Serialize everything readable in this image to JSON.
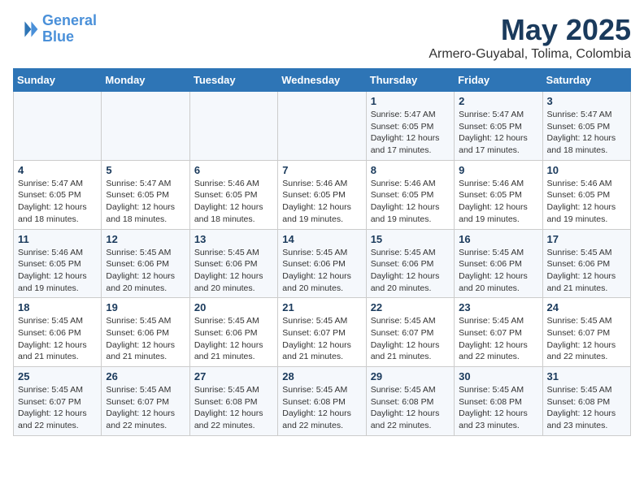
{
  "header": {
    "logo_line1": "General",
    "logo_line2": "Blue",
    "month_year": "May 2025",
    "location": "Armero-Guyabal, Tolima, Colombia"
  },
  "days_of_week": [
    "Sunday",
    "Monday",
    "Tuesday",
    "Wednesday",
    "Thursday",
    "Friday",
    "Saturday"
  ],
  "weeks": [
    [
      {
        "num": "",
        "info": ""
      },
      {
        "num": "",
        "info": ""
      },
      {
        "num": "",
        "info": ""
      },
      {
        "num": "",
        "info": ""
      },
      {
        "num": "1",
        "info": "Sunrise: 5:47 AM\nSunset: 6:05 PM\nDaylight: 12 hours\nand 17 minutes."
      },
      {
        "num": "2",
        "info": "Sunrise: 5:47 AM\nSunset: 6:05 PM\nDaylight: 12 hours\nand 17 minutes."
      },
      {
        "num": "3",
        "info": "Sunrise: 5:47 AM\nSunset: 6:05 PM\nDaylight: 12 hours\nand 18 minutes."
      }
    ],
    [
      {
        "num": "4",
        "info": "Sunrise: 5:47 AM\nSunset: 6:05 PM\nDaylight: 12 hours\nand 18 minutes."
      },
      {
        "num": "5",
        "info": "Sunrise: 5:47 AM\nSunset: 6:05 PM\nDaylight: 12 hours\nand 18 minutes."
      },
      {
        "num": "6",
        "info": "Sunrise: 5:46 AM\nSunset: 6:05 PM\nDaylight: 12 hours\nand 18 minutes."
      },
      {
        "num": "7",
        "info": "Sunrise: 5:46 AM\nSunset: 6:05 PM\nDaylight: 12 hours\nand 19 minutes."
      },
      {
        "num": "8",
        "info": "Sunrise: 5:46 AM\nSunset: 6:05 PM\nDaylight: 12 hours\nand 19 minutes."
      },
      {
        "num": "9",
        "info": "Sunrise: 5:46 AM\nSunset: 6:05 PM\nDaylight: 12 hours\nand 19 minutes."
      },
      {
        "num": "10",
        "info": "Sunrise: 5:46 AM\nSunset: 6:05 PM\nDaylight: 12 hours\nand 19 minutes."
      }
    ],
    [
      {
        "num": "11",
        "info": "Sunrise: 5:46 AM\nSunset: 6:05 PM\nDaylight: 12 hours\nand 19 minutes."
      },
      {
        "num": "12",
        "info": "Sunrise: 5:45 AM\nSunset: 6:06 PM\nDaylight: 12 hours\nand 20 minutes."
      },
      {
        "num": "13",
        "info": "Sunrise: 5:45 AM\nSunset: 6:06 PM\nDaylight: 12 hours\nand 20 minutes."
      },
      {
        "num": "14",
        "info": "Sunrise: 5:45 AM\nSunset: 6:06 PM\nDaylight: 12 hours\nand 20 minutes."
      },
      {
        "num": "15",
        "info": "Sunrise: 5:45 AM\nSunset: 6:06 PM\nDaylight: 12 hours\nand 20 minutes."
      },
      {
        "num": "16",
        "info": "Sunrise: 5:45 AM\nSunset: 6:06 PM\nDaylight: 12 hours\nand 20 minutes."
      },
      {
        "num": "17",
        "info": "Sunrise: 5:45 AM\nSunset: 6:06 PM\nDaylight: 12 hours\nand 21 minutes."
      }
    ],
    [
      {
        "num": "18",
        "info": "Sunrise: 5:45 AM\nSunset: 6:06 PM\nDaylight: 12 hours\nand 21 minutes."
      },
      {
        "num": "19",
        "info": "Sunrise: 5:45 AM\nSunset: 6:06 PM\nDaylight: 12 hours\nand 21 minutes."
      },
      {
        "num": "20",
        "info": "Sunrise: 5:45 AM\nSunset: 6:06 PM\nDaylight: 12 hours\nand 21 minutes."
      },
      {
        "num": "21",
        "info": "Sunrise: 5:45 AM\nSunset: 6:07 PM\nDaylight: 12 hours\nand 21 minutes."
      },
      {
        "num": "22",
        "info": "Sunrise: 5:45 AM\nSunset: 6:07 PM\nDaylight: 12 hours\nand 21 minutes."
      },
      {
        "num": "23",
        "info": "Sunrise: 5:45 AM\nSunset: 6:07 PM\nDaylight: 12 hours\nand 22 minutes."
      },
      {
        "num": "24",
        "info": "Sunrise: 5:45 AM\nSunset: 6:07 PM\nDaylight: 12 hours\nand 22 minutes."
      }
    ],
    [
      {
        "num": "25",
        "info": "Sunrise: 5:45 AM\nSunset: 6:07 PM\nDaylight: 12 hours\nand 22 minutes."
      },
      {
        "num": "26",
        "info": "Sunrise: 5:45 AM\nSunset: 6:07 PM\nDaylight: 12 hours\nand 22 minutes."
      },
      {
        "num": "27",
        "info": "Sunrise: 5:45 AM\nSunset: 6:08 PM\nDaylight: 12 hours\nand 22 minutes."
      },
      {
        "num": "28",
        "info": "Sunrise: 5:45 AM\nSunset: 6:08 PM\nDaylight: 12 hours\nand 22 minutes."
      },
      {
        "num": "29",
        "info": "Sunrise: 5:45 AM\nSunset: 6:08 PM\nDaylight: 12 hours\nand 22 minutes."
      },
      {
        "num": "30",
        "info": "Sunrise: 5:45 AM\nSunset: 6:08 PM\nDaylight: 12 hours\nand 23 minutes."
      },
      {
        "num": "31",
        "info": "Sunrise: 5:45 AM\nSunset: 6:08 PM\nDaylight: 12 hours\nand 23 minutes."
      }
    ]
  ]
}
